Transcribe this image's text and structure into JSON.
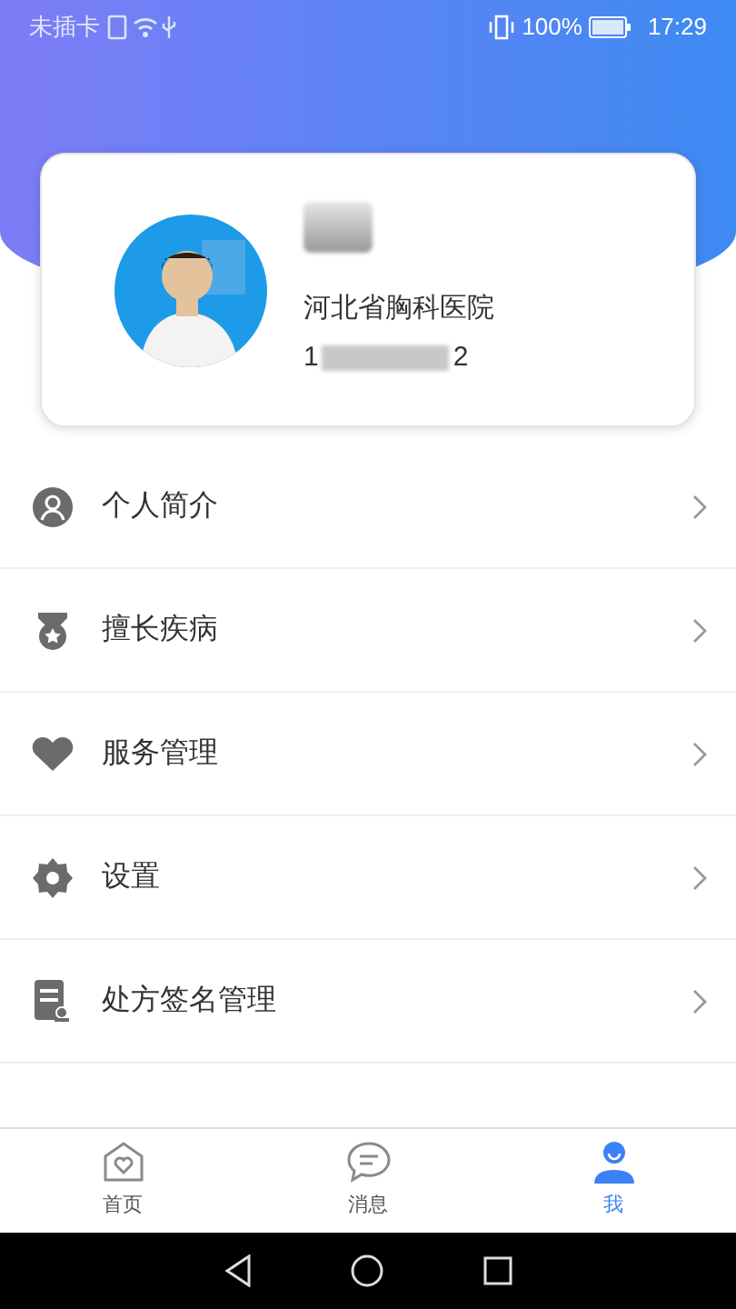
{
  "status_bar": {
    "carrier": "未插卡",
    "battery": "100%",
    "time": "17:29"
  },
  "profile": {
    "hospital": "河北省胸科医院",
    "phone_start": "1",
    "phone_end": "2"
  },
  "menu": [
    {
      "label": "个人简介"
    },
    {
      "label": "擅长疾病"
    },
    {
      "label": "服务管理"
    },
    {
      "label": "设置"
    },
    {
      "label": "处方签名管理"
    }
  ],
  "tabs": [
    {
      "label": "首页",
      "selected": false
    },
    {
      "label": "消息",
      "selected": false
    },
    {
      "label": "我",
      "selected": true
    }
  ]
}
